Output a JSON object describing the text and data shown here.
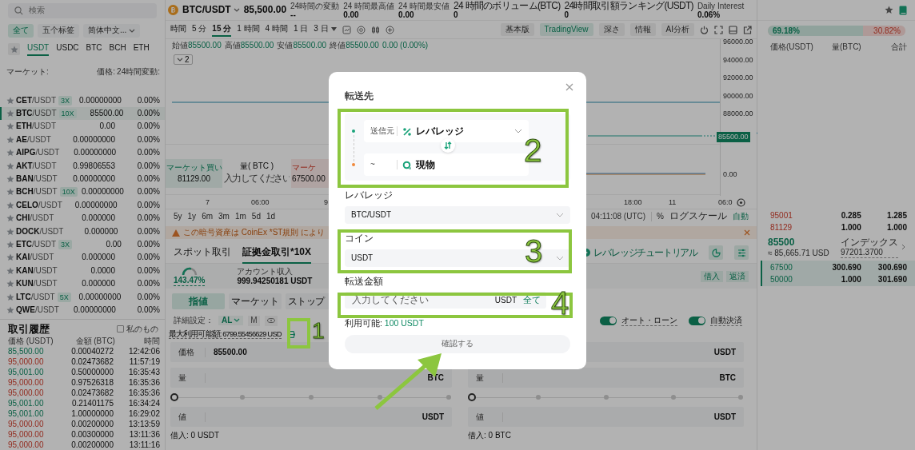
{
  "sidebar": {
    "search": {
      "placeholder": "検索"
    },
    "filters": [
      {
        "label": "全て",
        "selected": true,
        "kind": "tab"
      },
      {
        "label": "五个标签",
        "selected": false,
        "kind": "tab"
      },
      {
        "label": "简体中文...",
        "selected": false,
        "kind": "dropdown"
      }
    ],
    "quote_tabs": [
      {
        "label": "USDT",
        "selected": true
      },
      {
        "label": "USDC",
        "selected": false
      },
      {
        "label": "BTC",
        "selected": false
      },
      {
        "label": "BCH",
        "selected": false
      },
      {
        "label": "ETH",
        "selected": false
      }
    ],
    "market_columns": [
      "マーケット:",
      "価格:",
      "24時間変動:"
    ],
    "markets": [
      {
        "base": "CET",
        "quote": "/USDT",
        "badge": "3X",
        "price": "0.00000000",
        "change": "0.00%",
        "selected": false
      },
      {
        "base": "BTC",
        "quote": "/USDT",
        "badge": "10X",
        "price": "85500.00",
        "change": "0.00%",
        "selected": true
      },
      {
        "base": "ETH",
        "quote": "/USDT",
        "price": "0.00",
        "change": "0.00%",
        "selected": false
      },
      {
        "base": "AE",
        "quote": "/USDT",
        "price": "0.00000000",
        "change": "0.00%",
        "selected": false
      },
      {
        "base": "AIPG",
        "quote": "/USDT",
        "price": "0.00000000",
        "change": "0.00%",
        "selected": false
      },
      {
        "base": "AKT",
        "quote": "/USDT",
        "price": "0.99806553",
        "change": "0.00%",
        "selected": false
      },
      {
        "base": "BAN",
        "quote": "/USDT",
        "price": "0.00000000",
        "change": "0.00%",
        "selected": false
      },
      {
        "base": "BCH",
        "quote": "/USDT",
        "badge": "10X",
        "price": "0.00000000",
        "change": "0.00%",
        "selected": false
      },
      {
        "base": "CELO",
        "quote": "/USDT",
        "price": "0.00000000",
        "change": "0.00%",
        "selected": false
      },
      {
        "base": "CHI",
        "quote": "/USDT",
        "price": "0.000000",
        "change": "0.00%",
        "selected": false
      },
      {
        "base": "DOCK",
        "quote": "/USDT",
        "price": "0.000000",
        "change": "0.00%",
        "selected": false
      },
      {
        "base": "ETC",
        "quote": "/USDT",
        "badge": "3X",
        "price": "0.00",
        "change": "0.00%",
        "selected": false
      },
      {
        "base": "KAI",
        "quote": "/USDT",
        "price": "0.000000",
        "change": "0.00%",
        "selected": false
      },
      {
        "base": "KAN",
        "quote": "/USDT",
        "price": "0.0000",
        "change": "0.00%",
        "selected": false
      },
      {
        "base": "KUN",
        "quote": "/USDT",
        "price": "0.000000",
        "change": "0.00%",
        "selected": false
      },
      {
        "base": "LTC",
        "quote": "/USDT",
        "badge": "5X",
        "price": "0.00000000",
        "change": "0.00%",
        "selected": false
      },
      {
        "base": "QWE",
        "quote": "/USDT",
        "price": "0.00000000",
        "change": "0.00%",
        "selected": false
      }
    ],
    "history": {
      "title": "取引履歴",
      "mine": {
        "label": "私のもの",
        "checked": false
      },
      "columns": [
        "価格 (USDT)",
        "金額 (BTC)",
        "時間"
      ],
      "rows": [
        {
          "price": "85,500.00",
          "amount": "0.00040272",
          "time": "12:42:06",
          "kind": "buy"
        },
        {
          "price": "95,000.00",
          "amount": "0.02473682",
          "time": "11:57:19",
          "kind": "sell"
        },
        {
          "price": "95,001.00",
          "amount": "0.50000000",
          "time": "16:35:43",
          "kind": "buy"
        },
        {
          "price": "95,000.00",
          "amount": "0.97526318",
          "time": "16:35:36",
          "kind": "sell"
        },
        {
          "price": "95,000.00",
          "amount": "0.02473682",
          "time": "16:35:36",
          "kind": "sell"
        },
        {
          "price": "95,001.00",
          "amount": "0.21401175",
          "time": "16:34:24",
          "kind": "buy"
        },
        {
          "price": "95,001.00",
          "amount": "1.00000000",
          "time": "16:29:02",
          "kind": "buy"
        },
        {
          "price": "95,000.00",
          "amount": "0.00200000",
          "time": "13:13:59",
          "kind": "sell"
        },
        {
          "price": "95,000.00",
          "amount": "0.00300000",
          "time": "13:11:36",
          "kind": "sell"
        },
        {
          "price": "95,000.00",
          "amount": "0.00200000",
          "time": "13:11:16",
          "kind": "sell"
        }
      ]
    }
  },
  "ticker": {
    "pair": "BTC/USDT",
    "price": "85,500.00",
    "stats": [
      {
        "label": "24時間の変動",
        "value": "--"
      },
      {
        "label": "24 時間最高値",
        "value": "0.00"
      },
      {
        "label": "24 時間最安値",
        "value": "0.00"
      },
      {
        "label": "24 時間のボリューム(BTC)",
        "value": "0"
      },
      {
        "label": "24時間取引額ランキング(USDT)",
        "value": "0"
      },
      {
        "label": "Daily Interest",
        "value": "0.06%"
      }
    ]
  },
  "intervals": [
    {
      "label": "時間",
      "selected": false
    },
    {
      "label": "5 分",
      "selected": false
    },
    {
      "label": "15 分",
      "selected": true
    },
    {
      "label": "1 時間",
      "selected": false
    },
    {
      "label": "4 時間",
      "selected": false
    },
    {
      "label": "1 日",
      "selected": false
    },
    {
      "label": "3 日",
      "selected": false,
      "dropdown": true
    }
  ],
  "views": [
    {
      "label": "基本版",
      "selected": false
    },
    {
      "label": "TradingView",
      "selected": true
    },
    {
      "label": "深さ",
      "selected": false
    },
    {
      "label": "情報",
      "selected": false
    },
    {
      "label": "AI分析",
      "selected": false
    }
  ],
  "chart": {
    "legend": [
      {
        "label": "始値",
        "value": "85500.00"
      },
      {
        "label": "高値",
        "value": "85500.00"
      },
      {
        "label": "安値",
        "value": "85500.00"
      },
      {
        "label": "終値",
        "value": "85500.00"
      },
      {
        "value": "0.00 (0.00%)"
      }
    ],
    "collapse": "2",
    "price_axis": [
      "96000.00",
      "94000.00",
      "92000.00",
      "90000.00",
      "88000.00"
    ],
    "last_price": "85500.00",
    "sub_axis": "0.00",
    "time_axis": [
      "7",
      "06:00",
      "9",
      "18:00",
      "11",
      "06:0"
    ],
    "quick_trade": {
      "buy_label": "マーケット買い",
      "buy_price": "81129.00",
      "qty_label": "量( BTC )",
      "qty_placeholder": "入力してください",
      "sell_label": "マーケ",
      "sell_price": "67500.00"
    },
    "ranges": [
      "5y",
      "1y",
      "6m",
      "3m",
      "1m",
      "5d",
      "1d"
    ],
    "clock": "04:11:08 (UTC)",
    "percent": "%",
    "log": "ログスケール",
    "auto": "自動"
  },
  "warning": "この暗号資産は CoinEx *ST規則 により",
  "trade_tabs": [
    {
      "label": "スポット取引",
      "selected": false
    },
    {
      "label": "証拠金取引*10X",
      "selected": true
    }
  ],
  "tutorial": "レバレッジチュートリアル",
  "account": {
    "risk": "143.47%",
    "income_label": "アカウント収入",
    "income": "999.94250181 USDT",
    "actions": [
      "借入",
      "返済"
    ]
  },
  "order_types": [
    {
      "label": "指値",
      "selected": true
    },
    {
      "label": "マーケット",
      "selected": false
    },
    {
      "label": "ストップ",
      "selected": false
    }
  ],
  "settings": {
    "label": "詳細設定：",
    "mode": "AL",
    "m": "M"
  },
  "toggles": [
    {
      "label": "オート・ローン",
      "on": true
    },
    {
      "label": "自動決済",
      "on": true
    }
  ],
  "max_available": "最大利用可能額: 6799.55456629 USD",
  "forms": [
    {
      "fields": [
        {
          "kind": "input",
          "label": "価格",
          "value": "85500.00"
        },
        {
          "kind": "input",
          "label": "量",
          "unit": "BTC"
        },
        {
          "kind": "slider",
          "level": 0
        },
        {
          "kind": "input",
          "label": "値",
          "unit": "USDT"
        }
      ],
      "borrow": "借入: 0 USDT"
    },
    {
      "fields": [
        {
          "kind": "input",
          "unit": "USDT"
        },
        {
          "kind": "input",
          "label": "量",
          "unit": "BTC"
        },
        {
          "kind": "slider",
          "level": 0
        },
        {
          "kind": "input",
          "label": "値",
          "unit": "USDT"
        }
      ],
      "borrow": "借入: 0 BTC"
    }
  ],
  "orderbook": {
    "ratio": {
      "buy": "69.18%",
      "sell": "30.82%",
      "level": 0.6918
    },
    "columns": [
      "価格(USDT)",
      "量(BTC)",
      "合計"
    ],
    "asks": [
      {
        "price": "95001",
        "amount": "0.285",
        "total": "1.285"
      },
      {
        "price": "81129",
        "amount": "1.000",
        "total": "1.000"
      }
    ],
    "last": {
      "price": "85500",
      "usd": "≈ 85,665.71 USD",
      "index_label": "インデックス",
      "index": "97201.3700"
    },
    "bids": [
      {
        "price": "67500",
        "amount": "300.690",
        "total": "300.690"
      },
      {
        "price": "50000",
        "amount": "1.000",
        "total": "301.690"
      }
    ]
  },
  "modal": {
    "title": "転送先",
    "route": [
      {
        "label": "送信元",
        "account": "レバレッジ",
        "kind": "margin",
        "color": "#1aa37a",
        "dropdown": true
      },
      {
        "label": "~",
        "account": "現物",
        "kind": "spot",
        "color": "#f08a3c",
        "dropdown": false
      }
    ],
    "fields": [
      {
        "label": "レバレッジ",
        "value": "BTC/USDT"
      },
      {
        "label": "コイン",
        "value": "USDT"
      }
    ],
    "amount": {
      "label": "転送金額",
      "placeholder": "入力してください",
      "unit": "USDT",
      "max": "全て"
    },
    "available": {
      "label": "利用可能:",
      "value": "100 USDT"
    },
    "confirm": {
      "label": "確認する",
      "disabled": true
    }
  },
  "annotations": [
    {
      "label": "1"
    },
    {
      "label": "2"
    },
    {
      "label": "3"
    },
    {
      "label": "4"
    }
  ]
}
